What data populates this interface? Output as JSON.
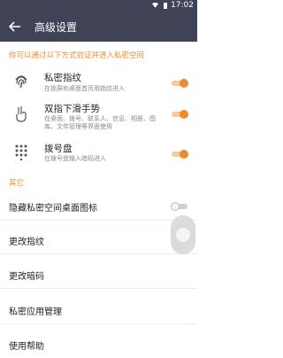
{
  "status": {
    "time": "17:02"
  },
  "header": {
    "title": "高级设置"
  },
  "intro": "你可以通过以下方式验证并进入私密空间",
  "methods": [
    {
      "title": "私密指纹",
      "desc": "在锁屏和桌面首页用指纹进入",
      "icon": "fingerprint-icon",
      "enabled": true
    },
    {
      "title": "双指下滑手势",
      "desc": "在桌面、拨号、联系人、信息、相册、图库、文件管理等界面使用",
      "icon": "two-finger-swipe-icon",
      "enabled": true
    },
    {
      "title": "拨号盘",
      "desc": "在拨号盘输入暗码进入",
      "icon": "dialpad-icon",
      "enabled": true
    }
  ],
  "other_caption": "其它",
  "other_items": [
    {
      "label": "隐藏私密空间桌面图标",
      "has_toggle": true,
      "enabled": false
    },
    {
      "label": "更改指纹"
    },
    {
      "label": "更改暗码"
    },
    {
      "label": "私密应用管理"
    },
    {
      "label": "使用帮助"
    }
  ],
  "colors": {
    "accent": "#ef8a2e",
    "appbar": "#3f4355"
  }
}
